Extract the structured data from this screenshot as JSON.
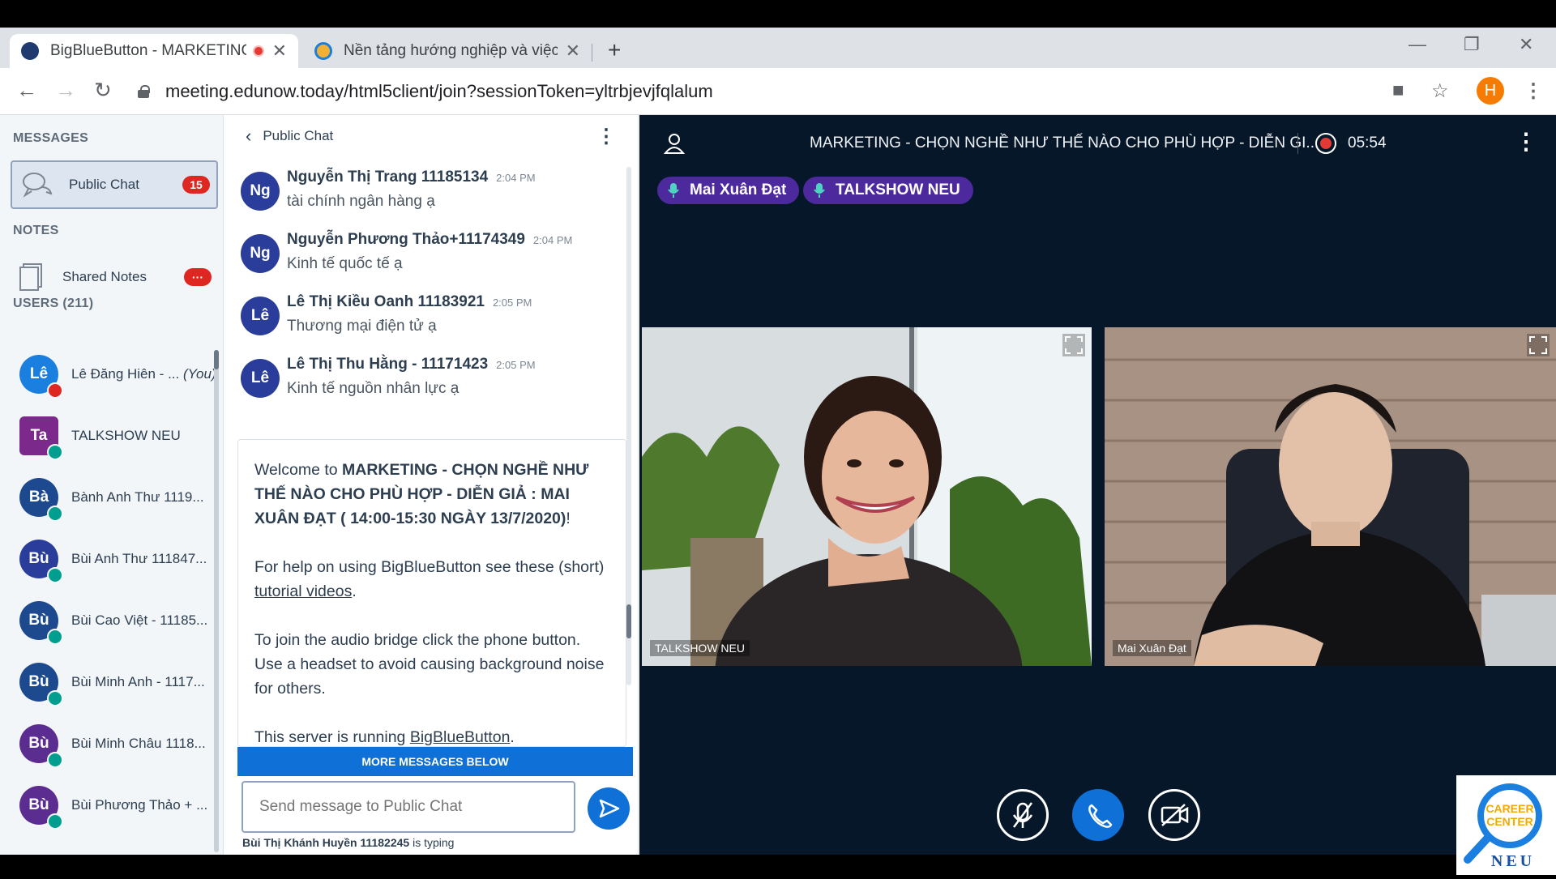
{
  "browser": {
    "tabs": [
      {
        "title": "BigBlueButton - MARKETING - CHỌN NGHỀ NHƯ THẾ NÀO CHO PHÙ HỢP",
        "recording": true
      },
      {
        "title": "Nền tảng hướng nghiệp và việc làm",
        "recording": false
      }
    ],
    "url": "meeting.edunow.today/html5client/join?sessionToken=yltrbjevjfqlalum",
    "profile_initial": "H"
  },
  "sidebar": {
    "messages_title": "MESSAGES",
    "public_chat_label": "Public Chat",
    "public_chat_unread": "15",
    "notes_title": "NOTES",
    "shared_notes_label": "Shared Notes",
    "shared_notes_badge": "···",
    "users_title": "USERS (211)",
    "users": [
      {
        "initials": "Lê",
        "name": "Lê Đăng Hiên - ...",
        "you": "(You)",
        "color": "#1b7fe0",
        "muted": true
      },
      {
        "initials": "Ta",
        "name": "TALKSHOW NEU",
        "color": "#7b2a8c",
        "presenter": true
      },
      {
        "initials": "Bà",
        "name": "Bành Anh Thư 1119...",
        "color": "#1d4a8f"
      },
      {
        "initials": "Bù",
        "name": "Bùi Anh Thư 111847...",
        "color": "#2a3d9a"
      },
      {
        "initials": "Bù",
        "name": "Bùi Cao Việt - 11185...",
        "color": "#1d4a8f"
      },
      {
        "initials": "Bù",
        "name": "Bùi Minh Anh - 1117...",
        "color": "#1d4a8f"
      },
      {
        "initials": "Bù",
        "name": "Bùi Minh Châu 1118...",
        "color": "#5c2d91"
      },
      {
        "initials": "Bù",
        "name": "Bùi Phương Thảo + ...",
        "color": "#5c2d91"
      }
    ]
  },
  "chat": {
    "title": "Public Chat",
    "messages": [
      {
        "initials": "Ng",
        "name": "Nguyễn Thị Trang 11185134",
        "time": "2:04 PM",
        "text": "tài chính ngân hàng ạ"
      },
      {
        "initials": "Ng",
        "name": "Nguyễn Phương Thảo+11174349",
        "time": "2:04 PM",
        "text": "Kinh tế quốc tế ạ"
      },
      {
        "initials": "Lê",
        "name": "Lê Thị Kiều Oanh 11183921",
        "time": "2:05 PM",
        "text": "Thương mại điện tử ạ"
      },
      {
        "initials": "Lê",
        "name": "Lê Thị Thu Hằng - 11171423",
        "time": "2:05 PM",
        "text": "Kinh tế nguồn nhân lực ạ"
      }
    ],
    "welcome": {
      "prefix": "Welcome to ",
      "meeting_name": "MARKETING - CHỌN NGHỀ NHƯ THẾ NÀO CHO PHÙ HỢP - DIỄN GIẢ : MAI XUÂN ĐẠT ( 14:00-15:30 NGÀY 13/7/2020)",
      "suffix": "!",
      "help_text": "For help on using BigBlueButton see these (short) ",
      "help_link": "tutorial videos",
      "audio_text": "To join the audio bridge click the phone button. Use a headset to avoid causing background noise for others.",
      "server_text": "This server is running ",
      "server_link": "BigBlueButton"
    },
    "more_below": "MORE MESSAGES BELOW",
    "input_placeholder": "Send message to Public Chat",
    "typing_user": "Bùi Thị Khánh Huyền 11182245",
    "typing_suffix": " is typing"
  },
  "stage": {
    "title": "MARKETING - CHỌN NGHỀ NHƯ THẾ NÀO CHO PHÙ HỢP - DIỄN GI...",
    "timer": "05:54",
    "talkers": [
      "Mai Xuân Đạt",
      "TALKSHOW NEU"
    ],
    "videos": [
      {
        "label": "TALKSHOW NEU"
      },
      {
        "label": "Mai Xuân Đạt"
      }
    ]
  },
  "logo": {
    "line1": "CAREER",
    "line2": "CENTER",
    "line3": "NEU"
  }
}
